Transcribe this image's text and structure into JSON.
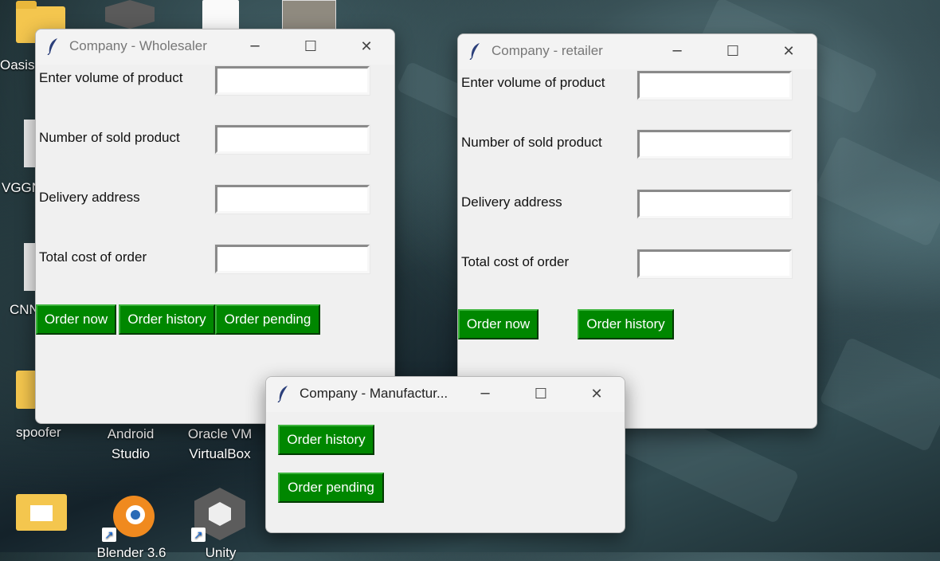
{
  "desktop": {
    "icons": [
      {
        "label": "Oasis"
      },
      {
        "label": "VGGN"
      },
      {
        "label": "CNN"
      },
      {
        "label": "spoofer"
      },
      {
        "label": "Android Studio"
      },
      {
        "label": "Oracle VM VirtualBox"
      },
      {
        "label": "Blender 3.6"
      },
      {
        "label": "Unity"
      }
    ]
  },
  "wholesaler": {
    "title": "Company - Wholesaler",
    "fields": [
      {
        "label": "Enter volume of product",
        "value": ""
      },
      {
        "label": "Number of sold product",
        "value": ""
      },
      {
        "label": "Delivery address",
        "value": ""
      },
      {
        "label": "Total cost of order",
        "value": ""
      }
    ],
    "buttons": [
      "Order now",
      "Order history",
      "Order pending"
    ]
  },
  "retailer": {
    "title": "Company - retailer",
    "fields": [
      {
        "label": "Enter volume of product",
        "value": ""
      },
      {
        "label": "Number of sold product",
        "value": ""
      },
      {
        "label": "Delivery address",
        "value": ""
      },
      {
        "label": "Total cost of order",
        "value": ""
      }
    ],
    "buttons": [
      "Order now",
      "Order history"
    ]
  },
  "manufacturer": {
    "title": "Company - Manufactur...",
    "buttons": [
      "Order history",
      "Order pending"
    ]
  },
  "controls": {
    "minimize": "─",
    "maximize": "☐",
    "close": "✕"
  },
  "colors": {
    "button_green": "#008700",
    "window_bg": "#f0f0f0"
  }
}
